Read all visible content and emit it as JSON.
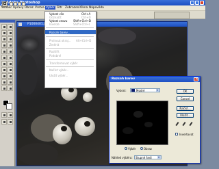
{
  "app": {
    "title": "Adobe Photoshop"
  },
  "menubar": {
    "items": [
      "Soubor",
      "Úpravy",
      "Obraz",
      "Vrstva",
      "Výběr",
      "Filtr",
      "Zobrazení",
      "Okna",
      "Nápověda"
    ],
    "active": "Výběr"
  },
  "document": {
    "title": "P1000401.JPG @ 50%"
  },
  "vyber_menu": {
    "items": [
      {
        "label": "Vybrat vše",
        "shortcut": "Ctrl+A",
        "enabled": true
      },
      {
        "label": "Odznačit",
        "shortcut": "Ctrl+D",
        "enabled": false
      },
      {
        "label": "Vybrat znovu",
        "shortcut": "Shift+Ctrl+D",
        "enabled": true
      },
      {
        "label": "Inverze",
        "shortcut": "Shift+Ctrl+I",
        "enabled": false
      },
      {
        "label": "Rozsah barev...",
        "shortcut": "",
        "enabled": true,
        "highlighted": true
      },
      {
        "label": "Prolnout okraj...",
        "shortcut": "Alt+Ctrl+D",
        "enabled": false
      },
      {
        "label": "Změnit",
        "shortcut": "",
        "enabled": false
      },
      {
        "label": "Rozšířit",
        "shortcut": "",
        "enabled": false
      },
      {
        "label": "Podobné",
        "shortcut": "",
        "enabled": false
      },
      {
        "label": "Transformovat výběr",
        "shortcut": "",
        "enabled": false
      },
      {
        "label": "Načíst výběr...",
        "shortcut": "",
        "enabled": false
      },
      {
        "label": "Uložit výběr...",
        "shortcut": "",
        "enabled": false
      }
    ]
  },
  "dialog": {
    "title": "Rozsah barev",
    "vybrat_label": "Vybrat:",
    "vybrat_value": "Modré",
    "radio_vyber": "Výběr",
    "radio_obraz": "Obraz",
    "nahled_label": "Náhled výběru:",
    "nahled_value": "Stupně šedi",
    "buttons": {
      "ok": "OK",
      "cancel": "Cancel",
      "nacist": "Načíst...",
      "ulozit": "Uložit..."
    },
    "invertovat_label": "Invertovat",
    "selected_swatch_color": "#0a1a6a"
  },
  "colors": {
    "titlebar": "#1c4fc2",
    "menu_highlight": "#316ac5",
    "foreground_color": "#000000",
    "background_color": "#ffffff"
  }
}
